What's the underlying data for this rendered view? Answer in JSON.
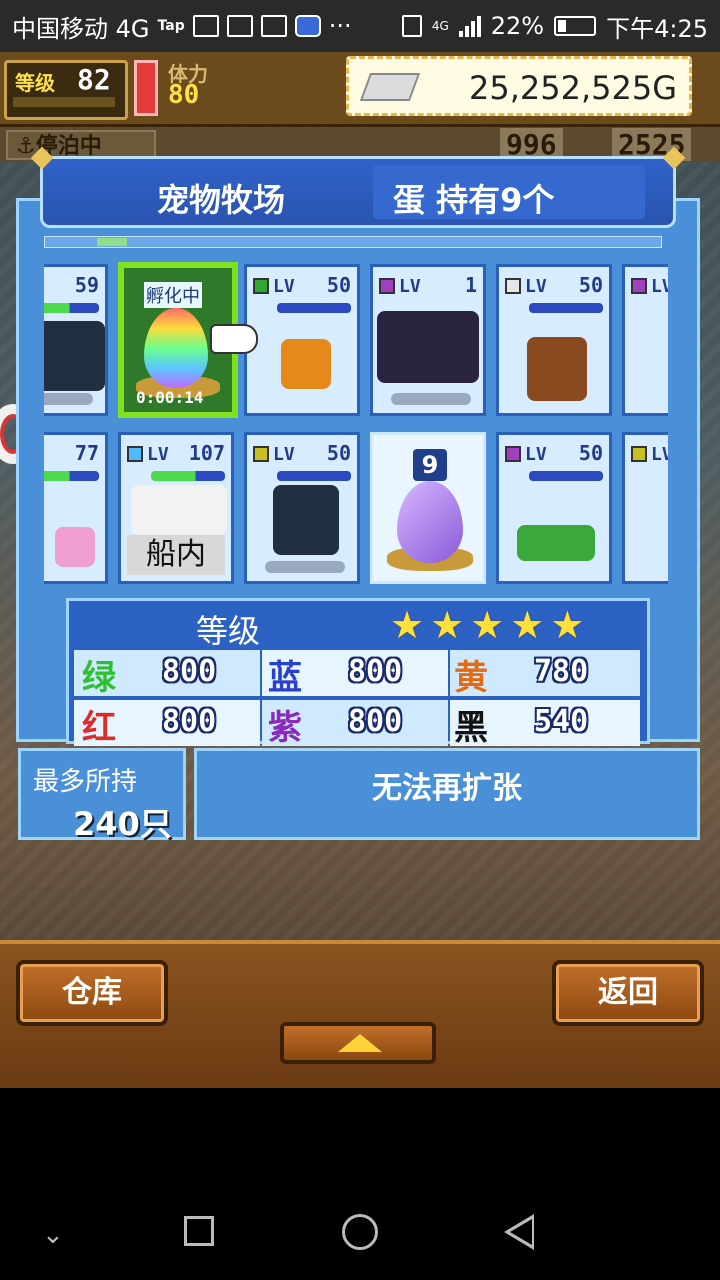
{
  "status_bar": {
    "carrier": "中国移动 4G",
    "tap": "Tap",
    "more": "···",
    "network": "4G",
    "battery": "22%",
    "time": "下午4:25",
    "battery_level": 0.22
  },
  "hud": {
    "level_label": "等级",
    "level_value": "82",
    "stamina_label": "体力",
    "stamina_value": "80",
    "gold": "25,252,525G",
    "anchor_label": "停泊中",
    "count1": "996",
    "count2": "2525"
  },
  "panel": {
    "title": "宠物牧场",
    "eggs_held": "蛋 持有9个"
  },
  "cards_row1": [
    {
      "gem_color": "#3b6ad9",
      "level": "59",
      "hp": "full"
    },
    {
      "status": "孵化中",
      "timer": "0:00:14",
      "selected": true
    },
    {
      "gem_color": "#2fa82f",
      "level": "50"
    },
    {
      "gem_color": "#a040c0",
      "level": "1"
    },
    {
      "gem_color": "#e6e6e6",
      "level": "50"
    },
    {
      "gem_color": "#a040c0",
      "level": ""
    }
  ],
  "cards_row2": [
    {
      "gem_color": "#3b6ad9",
      "level": "77"
    },
    {
      "gem_color": "#4fb8ff",
      "level": "107",
      "badge": "船内"
    },
    {
      "gem_color": "#c8c020",
      "level": "50"
    },
    {
      "egg_count": "9"
    },
    {
      "gem_color": "#a040c0",
      "level": "50"
    },
    {
      "gem_color": "#c8c020",
      "level": ""
    }
  ],
  "card_lv_text": "LV",
  "stats": {
    "label": "等级",
    "stars": 5,
    "rows": [
      [
        {
          "name": "绿",
          "color": "#2fc02f",
          "value": "800"
        },
        {
          "name": "蓝",
          "color": "#2a40c8",
          "value": "800"
        },
        {
          "name": "黄",
          "color": "#e86a10",
          "value": "780"
        }
      ],
      [
        {
          "name": "红",
          "color": "#e02a2a",
          "value": "800"
        },
        {
          "name": "紫",
          "color": "#8a2ab8",
          "value": "800"
        },
        {
          "name": "黑",
          "color": "#111111",
          "value": "540"
        }
      ]
    ]
  },
  "capacity": {
    "label": "最多所持",
    "value": "240只",
    "expand_label": "无法再扩张"
  },
  "buttons": {
    "warehouse": "仓库",
    "back": "返回"
  }
}
